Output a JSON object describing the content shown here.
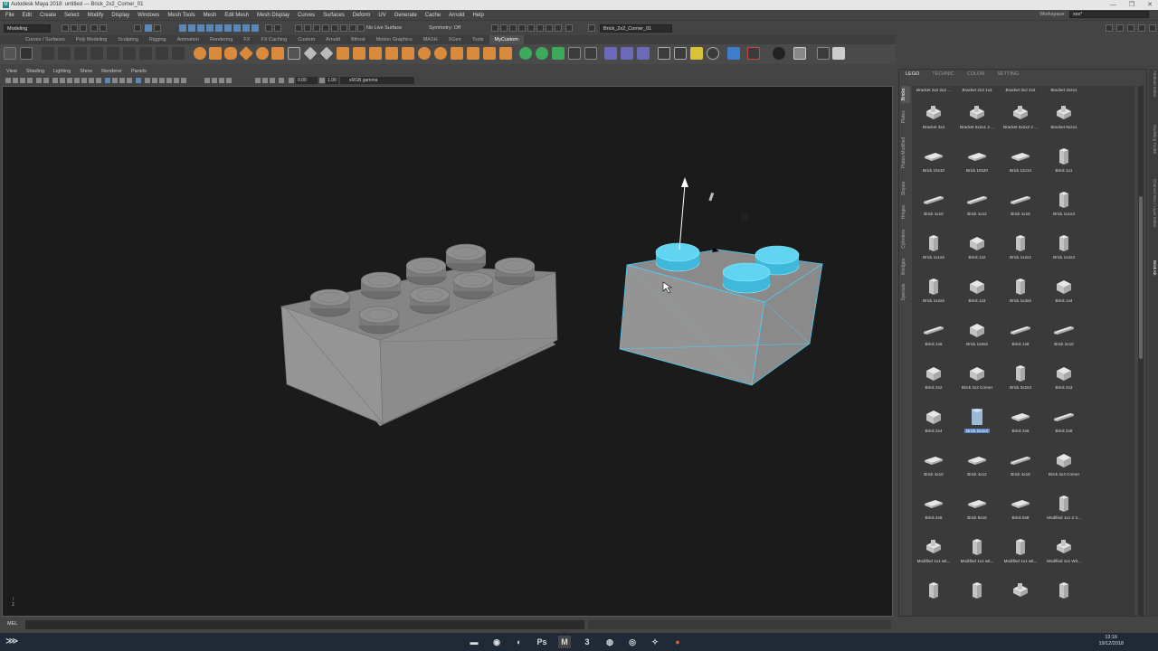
{
  "window": {
    "title": "Autodesk Maya 2018: untitled   ---   Brick_2x2_Corner_01",
    "app_icon": "M",
    "controls": [
      "—",
      "❐",
      "✕"
    ]
  },
  "menubar": [
    "File",
    "Edit",
    "Create",
    "Select",
    "Modify",
    "Display",
    "Windows",
    "Mesh Tools",
    "Mesh",
    "Edit Mesh",
    "Mesh Display",
    "Curves",
    "Surfaces",
    "Deform",
    "UV",
    "Generate",
    "Cache",
    "Arnold",
    "Help"
  ],
  "workspace": {
    "label": "Workspace:",
    "value": "xxx*"
  },
  "statusline": {
    "mode": "Modeling",
    "live_surface": "No Live Surface",
    "symmetry": "Symmetry: Off",
    "object_name": "Brick_2x2_Corner_01"
  },
  "shelf_tabs": [
    "Curves / Surfaces",
    "Poly Modeling",
    "Sculpting",
    "Rigging",
    "Animation",
    "Rendering",
    "FX",
    "FX Caching",
    "Custom",
    "Arnold",
    "Bifrost",
    "Motion Graphics",
    "MASH",
    "XGen",
    "Tools",
    "MyCustom"
  ],
  "viewport_menu": [
    "View",
    "Shading",
    "Lighting",
    "Show",
    "Renderer",
    "Panels"
  ],
  "viewport_toolbar": {
    "value1": "0.00",
    "value2": "1.00",
    "color_space": "sRGB gamma"
  },
  "axis_label": "y\nz",
  "cmdline": {
    "label": "MEL"
  },
  "panel": {
    "tabs": [
      "LEGO",
      "TECHNIC",
      "COLOR",
      "SETTING"
    ],
    "side_tabs": [
      "Bricks",
      "Plates",
      "Plates Modified",
      "Slopes",
      "Hinges",
      "Cylinders",
      "Wedges",
      "Specials"
    ],
    "top_labels": [
      "Bracket 2x2 2x2 ...",
      "Bracket 2x3 1x3",
      "Bracket 3x2 2x2",
      "Bracket 3x2x1"
    ],
    "items": [
      {
        "label": "Bracket 3x4",
        "shape": "bracket"
      },
      {
        "label": "Bracket 5x2x1 2 ...",
        "shape": "bracket"
      },
      {
        "label": "Bracket 5x2x2 2 ...",
        "shape": "bracket"
      },
      {
        "label": "Bracket 8x2x1",
        "shape": "bracket"
      },
      {
        "label": "Brick 10x10",
        "shape": "plate"
      },
      {
        "label": "Brick 10x20",
        "shape": "plate"
      },
      {
        "label": "Brick 12x14",
        "shape": "plate"
      },
      {
        "label": "Brick 1x1",
        "shape": "tall"
      },
      {
        "label": "Brick 1x10",
        "shape": "long"
      },
      {
        "label": "Brick 1x12",
        "shape": "long"
      },
      {
        "label": "Brick 1x16",
        "shape": "long"
      },
      {
        "label": "Brick 1x1x3",
        "shape": "tall"
      },
      {
        "label": "Brick 1x1x5",
        "shape": "tall"
      },
      {
        "label": "Brick 1x2",
        "shape": "cube"
      },
      {
        "label": "Brick 1x2x2",
        "shape": "tall"
      },
      {
        "label": "Brick 1x2x3",
        "shape": "tall"
      },
      {
        "label": "Brick 1x2x5",
        "shape": "tall"
      },
      {
        "label": "Brick 1x3",
        "shape": "cube"
      },
      {
        "label": "Brick 1x3x5",
        "shape": "tall"
      },
      {
        "label": "Brick 1x4",
        "shape": "cube"
      },
      {
        "label": "Brick 1x6",
        "shape": "long"
      },
      {
        "label": "Brick 1x6x5",
        "shape": "cube"
      },
      {
        "label": "Brick 1x8",
        "shape": "long"
      },
      {
        "label": "Brick 2x10",
        "shape": "long"
      },
      {
        "label": "Brick 2x2",
        "shape": "cube"
      },
      {
        "label": "Brick 2x2 Corner",
        "shape": "cube"
      },
      {
        "label": "Brick 2x2x3",
        "shape": "tall"
      },
      {
        "label": "Brick 2x3",
        "shape": "cube"
      },
      {
        "label": "Brick 2x4",
        "shape": "cube"
      },
      {
        "label": "Brick 2x4x3",
        "shape": "tallsel",
        "selected": true
      },
      {
        "label": "Brick 2x6",
        "shape": "plate"
      },
      {
        "label": "Brick 2x8",
        "shape": "long"
      },
      {
        "label": "Brick 4x10",
        "shape": "plate"
      },
      {
        "label": "Brick 4x12",
        "shape": "plate"
      },
      {
        "label": "Brick 4x18",
        "shape": "long"
      },
      {
        "label": "Brick 4x4 Corner",
        "shape": "cube"
      },
      {
        "label": "Brick 4x6",
        "shape": "plate"
      },
      {
        "label": "Brick 8x16",
        "shape": "plate"
      },
      {
        "label": "Brick 8x8",
        "shape": "plate"
      },
      {
        "label": "Modified 1x1 2 3...",
        "shape": "tall"
      },
      {
        "label": "Modified 1x1 wit...",
        "shape": "bracket"
      },
      {
        "label": "Modified 1x1 wit...",
        "shape": "tall"
      },
      {
        "label": "Modified 1x1 wit...",
        "shape": "tall"
      },
      {
        "label": "Modified 1x1 Wit...",
        "shape": "bracket"
      },
      {
        "label": "",
        "shape": "tall"
      },
      {
        "label": "",
        "shape": "tall"
      },
      {
        "label": "",
        "shape": "bracket"
      },
      {
        "label": "",
        "shape": "tall"
      }
    ]
  },
  "right_strip": [
    "Attribute Editor",
    "Modeling Toolkit",
    "Channel Box / Layer Editor",
    "Brick Kit"
  ],
  "taskbar": {
    "time": "13:16",
    "date": "19/12/2018"
  },
  "colors": {
    "selection": "#44d4ff",
    "viewport_bg": "#1b1b1b",
    "brick": "#9a9a9a"
  }
}
